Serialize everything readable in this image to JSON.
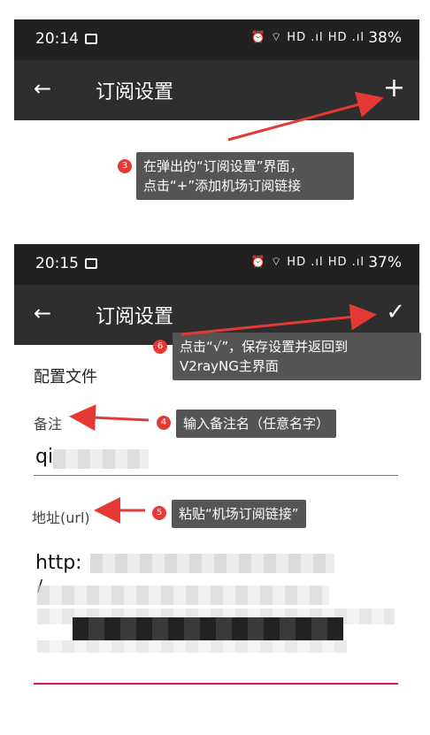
{
  "screen1": {
    "status": {
      "time": "20:14",
      "icons": "⏰ ⌔ HD .ıl HD .ıl",
      "battery": "38%"
    },
    "toolbar": {
      "back_icon": "←",
      "title": "订阅设置",
      "action_icon": "+"
    }
  },
  "callout3": {
    "badge": "3",
    "line1": "在弹出的“订阅设置”界面，",
    "line2": "点击“+”添加机场订阅链接"
  },
  "screen2": {
    "status": {
      "time": "20:15",
      "icons": "⏰ ⌔ HD .ıl HD .ıl",
      "battery": "37%"
    },
    "toolbar": {
      "back_icon": "←",
      "title": "订阅设置",
      "action_icon": "✓"
    },
    "form": {
      "section_title": "配置文件",
      "remark_label": "备注",
      "remark_value": "qi",
      "url_label": "地址(url)",
      "url_value": "http:",
      "url_value_line2": "/"
    }
  },
  "callout6": {
    "badge": "6",
    "line1": "点击“√”，保存设置并返回到",
    "line2": "V2rayNG主界面"
  },
  "callout4": {
    "badge": "4",
    "text": "输入备注名（任意名字）"
  },
  "callout5": {
    "badge": "5",
    "text": "粘贴“机场订阅链接”"
  },
  "colors": {
    "arrow": "#e53935",
    "accent_underline": "#d81b60"
  }
}
